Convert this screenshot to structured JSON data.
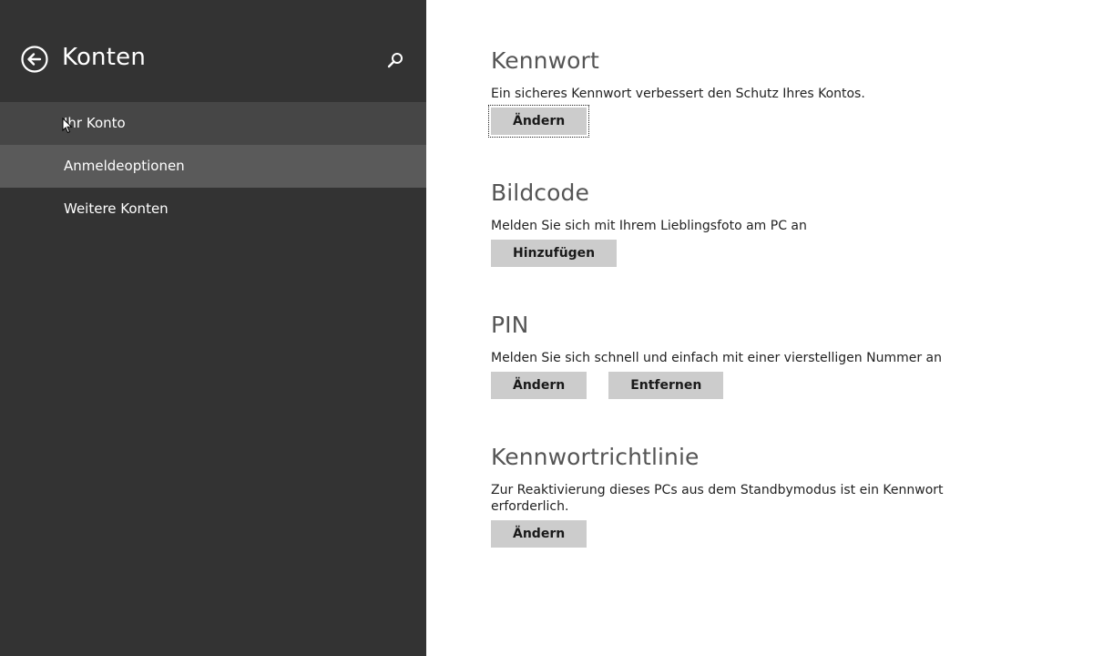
{
  "sidebar": {
    "title": "Konten",
    "back_icon": "back-arrow-circle-icon",
    "search_icon": "search-icon",
    "items": [
      {
        "label": "Ihr Konto",
        "state": "hover"
      },
      {
        "label": "Anmeldeoptionen",
        "state": "selected"
      },
      {
        "label": "Weitere Konten",
        "state": "normal"
      }
    ]
  },
  "main": {
    "sections": [
      {
        "title": "Kennwort",
        "description": "Ein sicheres Kennwort verbessert den Schutz Ihres Kontos.",
        "buttons": [
          "Ändern"
        ]
      },
      {
        "title": "Bildcode",
        "description": "Melden Sie sich mit Ihrem Lieblingsfoto am PC an",
        "buttons": [
          "Hinzufügen"
        ]
      },
      {
        "title": "PIN",
        "description": "Melden Sie sich schnell und einfach mit einer vierstelligen Nummer an",
        "buttons": [
          "Ändern",
          "Entfernen"
        ]
      },
      {
        "title": "Kennwortrichtlinie",
        "description": "Zur Reaktivierung dieses PCs aus dem Standbymodus ist ein Kennwort erforderlich.",
        "buttons": [
          "Ändern"
        ]
      }
    ]
  },
  "colors": {
    "sidebar_bg": "#333333",
    "nav_selected": "#5a5a5a",
    "nav_hover": "#464646",
    "content_bg": "#ffffff",
    "button_bg": "#cccccc"
  }
}
